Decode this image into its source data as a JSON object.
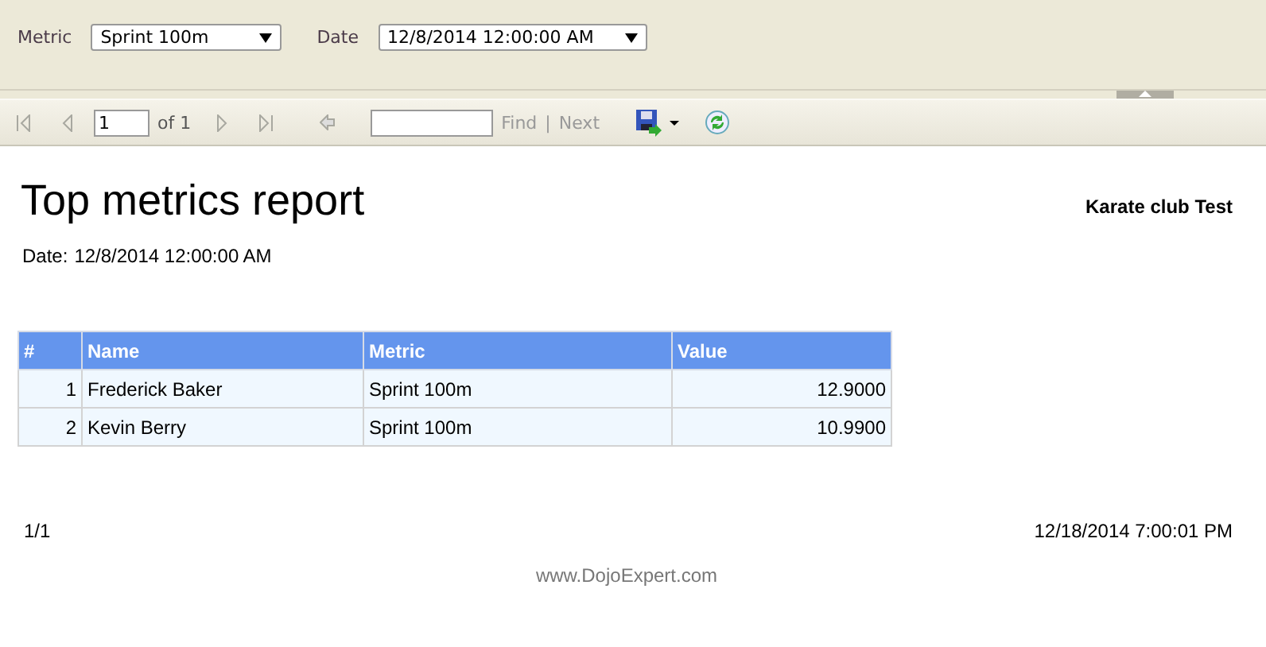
{
  "parameters": [
    {
      "label": "Metric",
      "value": "Sprint 100m"
    },
    {
      "label": "Date",
      "value": "12/8/2014 12:00:00 AM"
    }
  ],
  "toolbar": {
    "page": "1",
    "page_count": "of 1",
    "links": [
      {
        "label": "Find",
        "disabled": true
      },
      {
        "label": "|",
        "disabled": true
      },
      {
        "label": "Next",
        "disabled": true
      }
    ]
  },
  "report": {
    "title": "Top metrics report",
    "company": "Karate club Test",
    "date_label": "Date:",
    "date": "12/8/2014 12:00:00 AM",
    "table": {
      "columns": [
        "#",
        "Name",
        "Metric",
        "Value"
      ],
      "rows": [
        [
          "1",
          "Frederick Baker",
          "Sprint 100m",
          "12.9000"
        ],
        [
          "2",
          "Kevin Berry",
          "Sprint 100m",
          "10.9900"
        ]
      ]
    },
    "page_number": "1/1",
    "printed": "12/18/2014 7:00:01 PM",
    "site": "www.DojoExpert.com"
  }
}
